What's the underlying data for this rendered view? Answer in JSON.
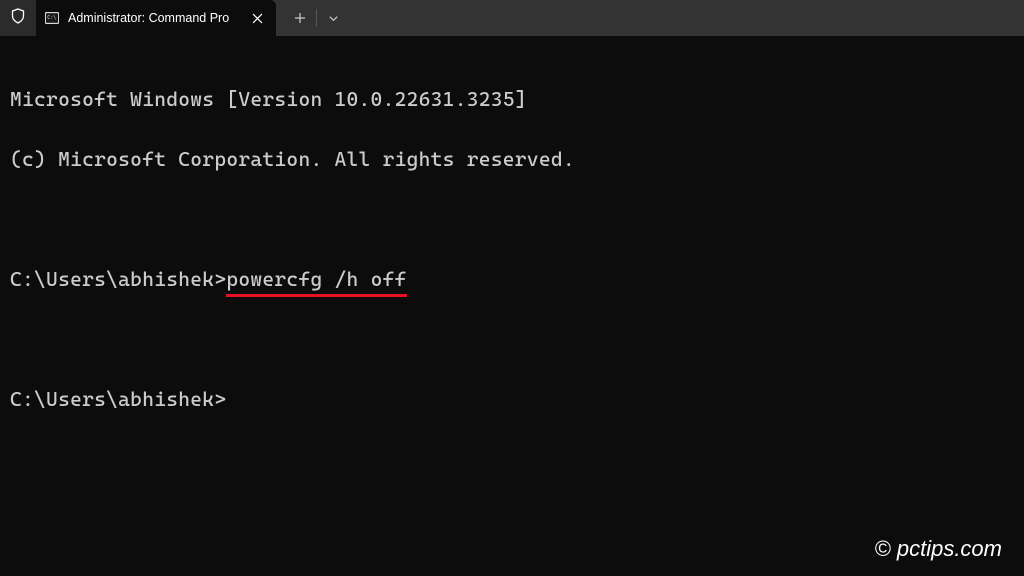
{
  "titlebar": {
    "tab_title": "Administrator: Command Pro"
  },
  "terminal": {
    "line1": "Microsoft Windows [Version 10.0.22631.3235]",
    "line2": "(c) Microsoft Corporation. All rights reserved.",
    "prompt1_path": "C:\\Users\\abhishek>",
    "prompt1_cmd": "powercfg /h off",
    "prompt2_path": "C:\\Users\\abhishek>"
  },
  "annotation": {
    "underline_color": "#e81123"
  },
  "watermark": "© pctips.com"
}
